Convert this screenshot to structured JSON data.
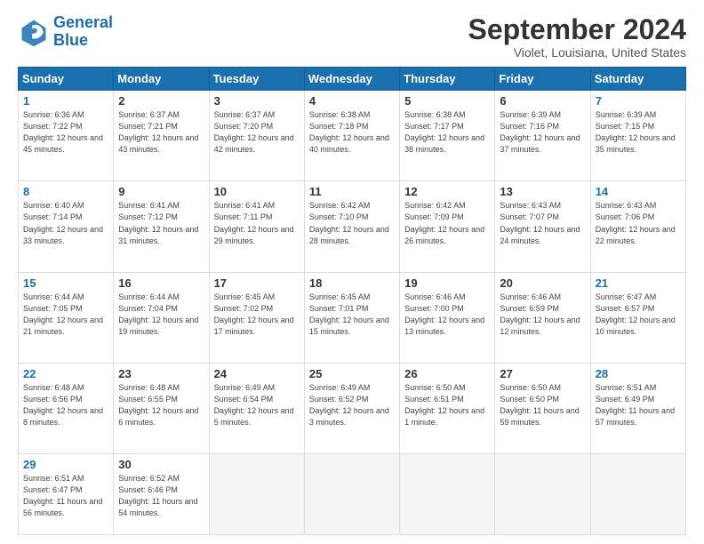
{
  "header": {
    "logo_line1": "General",
    "logo_line2": "Blue",
    "month": "September 2024",
    "location": "Violet, Louisiana, United States"
  },
  "days_of_week": [
    "Sunday",
    "Monday",
    "Tuesday",
    "Wednesday",
    "Thursday",
    "Friday",
    "Saturday"
  ],
  "weeks": [
    [
      {
        "day": "1",
        "sunrise": "6:36 AM",
        "sunset": "7:22 PM",
        "daylight": "12 hours and 45 minutes."
      },
      {
        "day": "2",
        "sunrise": "6:37 AM",
        "sunset": "7:21 PM",
        "daylight": "12 hours and 43 minutes."
      },
      {
        "day": "3",
        "sunrise": "6:37 AM",
        "sunset": "7:20 PM",
        "daylight": "12 hours and 42 minutes."
      },
      {
        "day": "4",
        "sunrise": "6:38 AM",
        "sunset": "7:18 PM",
        "daylight": "12 hours and 40 minutes."
      },
      {
        "day": "5",
        "sunrise": "6:38 AM",
        "sunset": "7:17 PM",
        "daylight": "12 hours and 38 minutes."
      },
      {
        "day": "6",
        "sunrise": "6:39 AM",
        "sunset": "7:16 PM",
        "daylight": "12 hours and 37 minutes."
      },
      {
        "day": "7",
        "sunrise": "6:39 AM",
        "sunset": "7:15 PM",
        "daylight": "12 hours and 35 minutes."
      }
    ],
    [
      {
        "day": "8",
        "sunrise": "6:40 AM",
        "sunset": "7:14 PM",
        "daylight": "12 hours and 33 minutes."
      },
      {
        "day": "9",
        "sunrise": "6:41 AM",
        "sunset": "7:12 PM",
        "daylight": "12 hours and 31 minutes."
      },
      {
        "day": "10",
        "sunrise": "6:41 AM",
        "sunset": "7:11 PM",
        "daylight": "12 hours and 29 minutes."
      },
      {
        "day": "11",
        "sunrise": "6:42 AM",
        "sunset": "7:10 PM",
        "daylight": "12 hours and 28 minutes."
      },
      {
        "day": "12",
        "sunrise": "6:42 AM",
        "sunset": "7:09 PM",
        "daylight": "12 hours and 26 minutes."
      },
      {
        "day": "13",
        "sunrise": "6:43 AM",
        "sunset": "7:07 PM",
        "daylight": "12 hours and 24 minutes."
      },
      {
        "day": "14",
        "sunrise": "6:43 AM",
        "sunset": "7:06 PM",
        "daylight": "12 hours and 22 minutes."
      }
    ],
    [
      {
        "day": "15",
        "sunrise": "6:44 AM",
        "sunset": "7:05 PM",
        "daylight": "12 hours and 21 minutes."
      },
      {
        "day": "16",
        "sunrise": "6:44 AM",
        "sunset": "7:04 PM",
        "daylight": "12 hours and 19 minutes."
      },
      {
        "day": "17",
        "sunrise": "6:45 AM",
        "sunset": "7:02 PM",
        "daylight": "12 hours and 17 minutes."
      },
      {
        "day": "18",
        "sunrise": "6:45 AM",
        "sunset": "7:01 PM",
        "daylight": "12 hours and 15 minutes."
      },
      {
        "day": "19",
        "sunrise": "6:46 AM",
        "sunset": "7:00 PM",
        "daylight": "12 hours and 13 minutes."
      },
      {
        "day": "20",
        "sunrise": "6:46 AM",
        "sunset": "6:59 PM",
        "daylight": "12 hours and 12 minutes."
      },
      {
        "day": "21",
        "sunrise": "6:47 AM",
        "sunset": "6:57 PM",
        "daylight": "12 hours and 10 minutes."
      }
    ],
    [
      {
        "day": "22",
        "sunrise": "6:48 AM",
        "sunset": "6:56 PM",
        "daylight": "12 hours and 8 minutes."
      },
      {
        "day": "23",
        "sunrise": "6:48 AM",
        "sunset": "6:55 PM",
        "daylight": "12 hours and 6 minutes."
      },
      {
        "day": "24",
        "sunrise": "6:49 AM",
        "sunset": "6:54 PM",
        "daylight": "12 hours and 5 minutes."
      },
      {
        "day": "25",
        "sunrise": "6:49 AM",
        "sunset": "6:52 PM",
        "daylight": "12 hours and 3 minutes."
      },
      {
        "day": "26",
        "sunrise": "6:50 AM",
        "sunset": "6:51 PM",
        "daylight": "12 hours and 1 minute."
      },
      {
        "day": "27",
        "sunrise": "6:50 AM",
        "sunset": "6:50 PM",
        "daylight": "11 hours and 59 minutes."
      },
      {
        "day": "28",
        "sunrise": "6:51 AM",
        "sunset": "6:49 PM",
        "daylight": "11 hours and 57 minutes."
      }
    ],
    [
      {
        "day": "29",
        "sunrise": "6:51 AM",
        "sunset": "6:47 PM",
        "daylight": "11 hours and 56 minutes."
      },
      {
        "day": "30",
        "sunrise": "6:52 AM",
        "sunset": "6:46 PM",
        "daylight": "11 hours and 54 minutes."
      },
      null,
      null,
      null,
      null,
      null
    ]
  ]
}
